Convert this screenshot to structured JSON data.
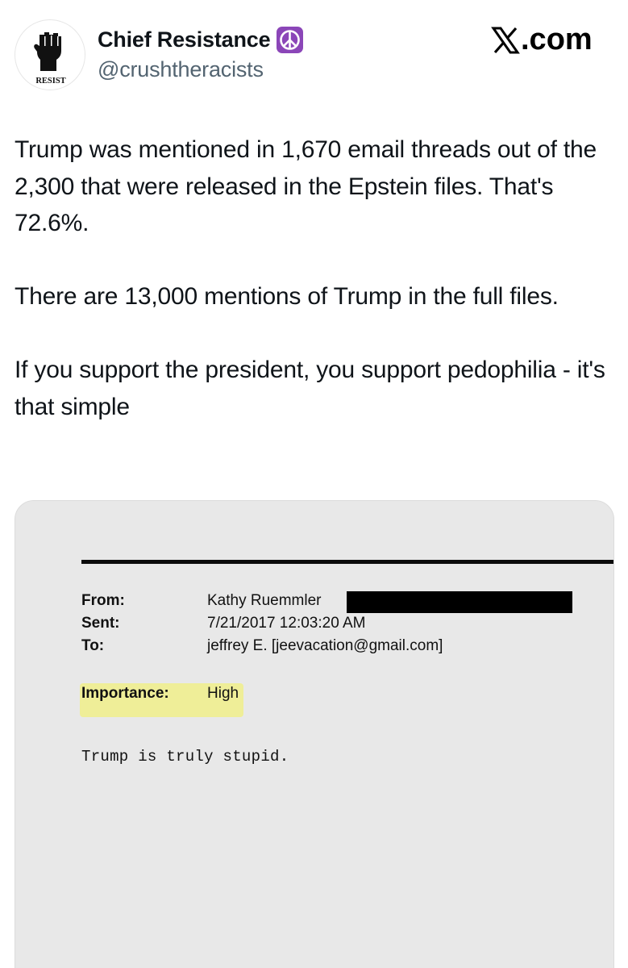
{
  "header": {
    "display_name": "Chief Resistance",
    "handle": "@crushtheracists",
    "avatar_text": "RESIST",
    "brand": "X.com",
    "name_badge_icon": "peace-sign-icon"
  },
  "tweet": {
    "paragraphs": [
      "Trump was mentioned in 1,670 email threads out of the 2,300 that were released in the Epstein files. That's 72.6%.",
      "There are 13,000 mentions of Trump in the full files.",
      "If you support the president, you support pedophilia - it's that simple"
    ]
  },
  "email": {
    "from_label": "From:",
    "from_value": "Kathy Ruemmler",
    "sent_label": "Sent:",
    "sent_value": "7/21/2017 12:03:20 AM",
    "to_label": "To:",
    "to_value": "jeffrey E. [jeevacation@gmail.com]",
    "importance_label": "Importance:",
    "importance_value": "High",
    "body": "Trump is truly stupid."
  },
  "colors": {
    "handle": "#536471",
    "badge": "#8b46b8",
    "media_bg": "#e8e8e8",
    "highlight": "#f2f07e"
  }
}
